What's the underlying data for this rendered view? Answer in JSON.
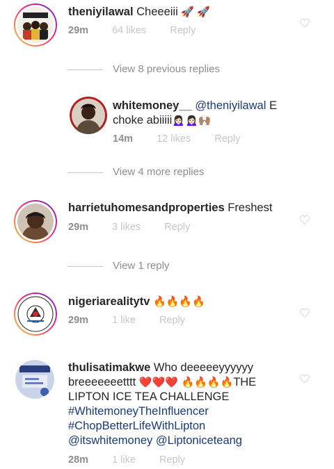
{
  "comments": [
    {
      "username": "theniyilawal",
      "text": "Cheeeiii",
      "emoji": "🚀 🚀",
      "time": "29m",
      "likes": "64 likes",
      "reply": "Reply"
    },
    {
      "replies_toggle": "View 8 previous replies"
    },
    {
      "username": "whitemoney__",
      "mention": "@theniyilawal",
      "text_line1_end": " E",
      "text_line2": "choke abiiiii",
      "emoji": "🙍🏻‍♀️🙍🏻‍♀️🙌🏽",
      "time": "14m",
      "likes": "12 likes",
      "reply": "Reply"
    },
    {
      "replies_toggle": "View 4 more replies"
    },
    {
      "username": "harrietuhomesandproperties",
      "text": "Freshest",
      "time": "29m",
      "likes": "3 likes",
      "reply": "Reply"
    },
    {
      "replies_toggle": "View 1 reply"
    },
    {
      "username": "nigeriarealitytv",
      "emoji": "🔥🔥🔥🔥",
      "time": "29m",
      "likes": "1 like",
      "reply": "Reply"
    },
    {
      "username": "thulisatimakwe",
      "text_line1": "Who deeeeeyyyyyy",
      "text_line2_a": "breeeeeeetttt",
      "emoji_hearts": "❤️❤️❤️",
      "emoji_fire": "🔥🔥🔥🔥",
      "text_line2_b": "THE",
      "text_line3": "LIPTON ICE TEA CHALLENGE",
      "hashtag1": "#WhitemoneyTheInfluencer",
      "hashtag2": "#ChopBetterLifeWithLipton",
      "mention1": "@itswhitemoney",
      "mention2": "@Liptoniceteang",
      "time": "28m",
      "likes": "1 like",
      "reply": "Reply"
    }
  ],
  "avatar_texts": {
    "nigeria_reality_top": "NIGERIA REALITY",
    "nigeria_reality_bottom": "TV"
  },
  "colors": {
    "meta_gray": "#8e8e8e",
    "light_gray": "#c7c7c7",
    "link_blue": "#1a3a78",
    "story_ring": "#ee2a7b"
  }
}
